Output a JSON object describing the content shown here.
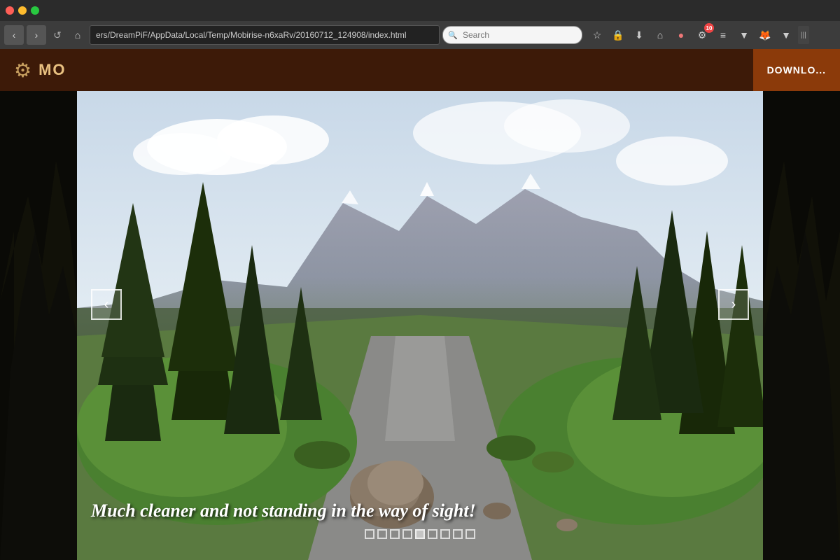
{
  "browser": {
    "address": "ers/DreamPiF/AppData/Local/Temp/Mobirise-n6xaRv/20160712_124908/index.html",
    "search_placeholder": "Search",
    "refresh_label": "↺",
    "back_label": "‹",
    "forward_label": "›",
    "bookmark_icon": "☆",
    "lock_icon": "🔒",
    "download_nav_icon": "⬇",
    "home_icon": "⌂",
    "badge_count": "10"
  },
  "app": {
    "name": "MO",
    "gear_symbol": "⚙",
    "download_button": "DOWNLO..."
  },
  "slider": {
    "caption": "Much cleaner and not standing in the way of sight!",
    "prev_label": "‹",
    "next_label": "›",
    "dots": [
      {
        "active": false
      },
      {
        "active": false
      },
      {
        "active": false
      },
      {
        "active": false
      },
      {
        "active": true
      },
      {
        "active": false
      },
      {
        "active": false
      },
      {
        "active": false
      },
      {
        "active": false
      }
    ]
  },
  "colors": {
    "accent": "#c8a060",
    "header_bg": "#3d1a08",
    "download_bg": "#8B3A0A"
  }
}
